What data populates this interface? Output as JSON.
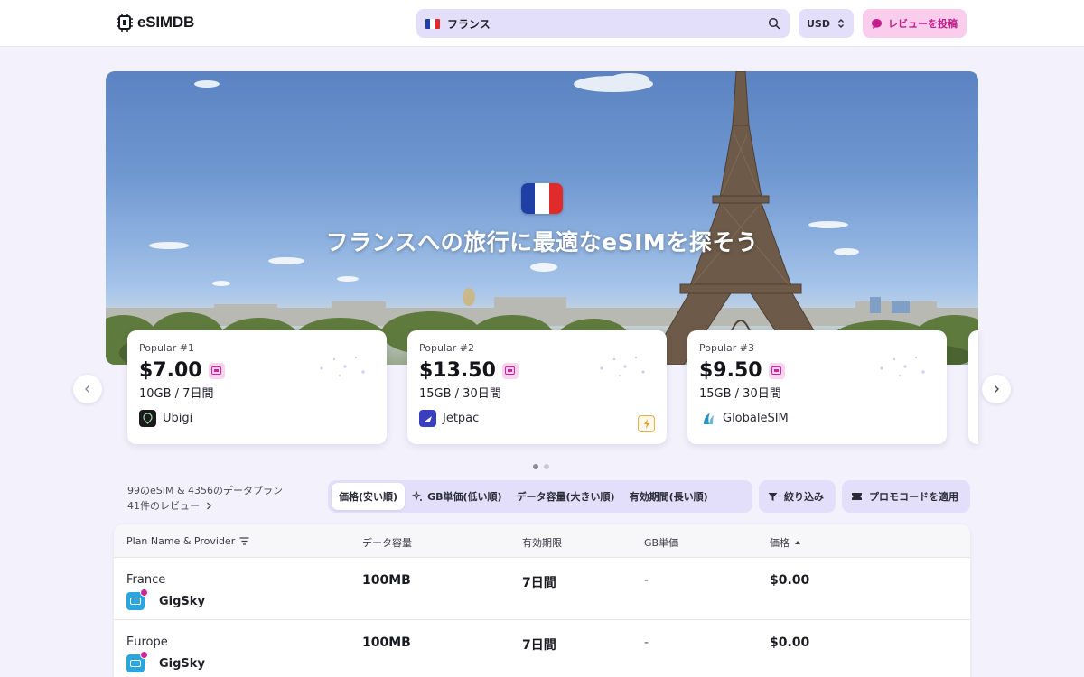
{
  "header": {
    "logo_text": "eSIMDB",
    "search": {
      "value": "フランス",
      "flag": [
        "#1f3fa6",
        "#ffffff",
        "#e02b2b"
      ]
    },
    "currency": "USD",
    "review_button": "レビューを投稿"
  },
  "hero": {
    "title": "フランスへの旅行に最適なeSIMを探そう",
    "flag": [
      "#1f3fa6",
      "#ffffff",
      "#e02b2b"
    ]
  },
  "popular": [
    {
      "rank": "Popular #1",
      "price": "$7.00",
      "plan": "10GB / 7日間",
      "provider": "Ubigi",
      "logo_color": "#1b1b1b"
    },
    {
      "rank": "Popular #2",
      "price": "$13.50",
      "plan": "15GB / 30日間",
      "provider": "Jetpac",
      "logo_color": "#3a3fbf"
    },
    {
      "rank": "Popular #3",
      "price": "$9.50",
      "plan": "15GB / 30日間",
      "provider": "GlobaleSIM",
      "logo_color": "#2b8fc0"
    }
  ],
  "summary": {
    "counts": "99のeSIM & 4356のデータプラン",
    "reviews": "41件のレビュー"
  },
  "sort": {
    "options": [
      "価格(安い順)",
      "GB単価(低い順)",
      "データ容量(大きい順)",
      "有効期間(長い順)"
    ],
    "active": 0
  },
  "filters": {
    "filter_label": "絞り込み",
    "promo_label": "プロモコードを適用"
  },
  "table": {
    "headers": [
      "Plan Name & Provider",
      "データ容量",
      "有効期限",
      "GB単価",
      "価格"
    ],
    "rows": [
      {
        "plan": "France",
        "provider": "GigSky",
        "data": "100MB",
        "validity": "7日間",
        "per_gb": "-",
        "price": "$0.00"
      },
      {
        "plan": "Europe",
        "provider": "GigSky",
        "data": "100MB",
        "validity": "7日間",
        "per_gb": "-",
        "price": "$0.00"
      }
    ]
  },
  "colors": {
    "accent_lavender": "#e3defa",
    "accent_pink": "#fbcdec",
    "accent_pink_text": "#c01e8a",
    "page_bg": "#f3f1fb"
  }
}
